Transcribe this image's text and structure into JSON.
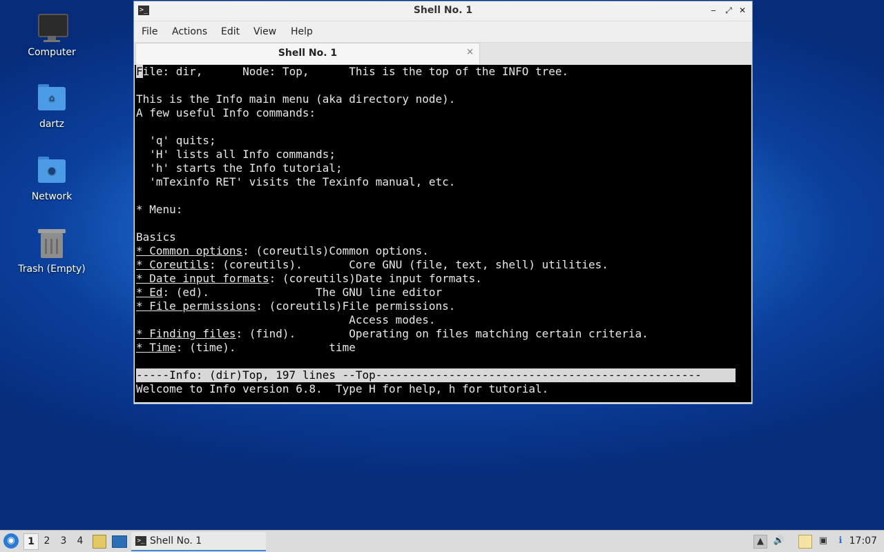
{
  "desktop": {
    "icons": [
      {
        "label": "Computer"
      },
      {
        "label": "dartz"
      },
      {
        "label": "Network"
      },
      {
        "label": "Trash (Empty)"
      }
    ]
  },
  "window": {
    "title": "Shell No. 1",
    "menu": [
      "File",
      "Actions",
      "Edit",
      "View",
      "Help"
    ],
    "tab_label": "Shell No. 1",
    "tab_close": "×",
    "controls": {
      "minimize": "‒",
      "maximize": "⤢",
      "close": "✕"
    }
  },
  "terminal": {
    "header_cursor": "F",
    "header_rest": "ile: dir,      Node: Top,      This is the top of the INFO tree.",
    "intro": [
      "This is the Info main menu (aka directory node).",
      "A few useful Info commands:",
      "  'q' quits;",
      "  'H' lists all Info commands;",
      "  'h' starts the Info tutorial;",
      "  'mTexinfo RET' visits the Texinfo manual, etc.",
      "* Menu:",
      "Basics"
    ],
    "menu_entries": [
      {
        "link": "* Common options",
        "rest": ": (coreutils)Common options."
      },
      {
        "link": "* Coreutils",
        "rest": ": (coreutils).       Core GNU (file, text, shell) utilities."
      },
      {
        "link": "* Date input formats",
        "rest": ": (coreutils)Date input formats."
      },
      {
        "link": "* Ed",
        "rest": ": (ed).                The GNU line editor"
      },
      {
        "link": "* File permissions",
        "rest": ": (coreutils)File permissions."
      },
      {
        "link": "",
        "rest": "                                Access modes."
      },
      {
        "link": "* Finding files",
        "rest": ": (find).        Operating on files matching certain criteria."
      },
      {
        "link": "* Time",
        "rest": ": (time).              time"
      }
    ],
    "status_line": "-----Info: (dir)Top, 197 lines --Top-------------------------------------------------",
    "echo_line": "Welcome to Info version 6.8.  Type H for help, h for tutorial."
  },
  "taskbar": {
    "workspaces": [
      "1",
      "2",
      "3",
      "4"
    ],
    "active_workspace": "1",
    "task_label": "Shell No. 1",
    "clock": "17:07"
  },
  "colors": {
    "accent": "#3a86d4",
    "terminal_bg": "#000000",
    "terminal_fg": "#e8e8e8"
  }
}
